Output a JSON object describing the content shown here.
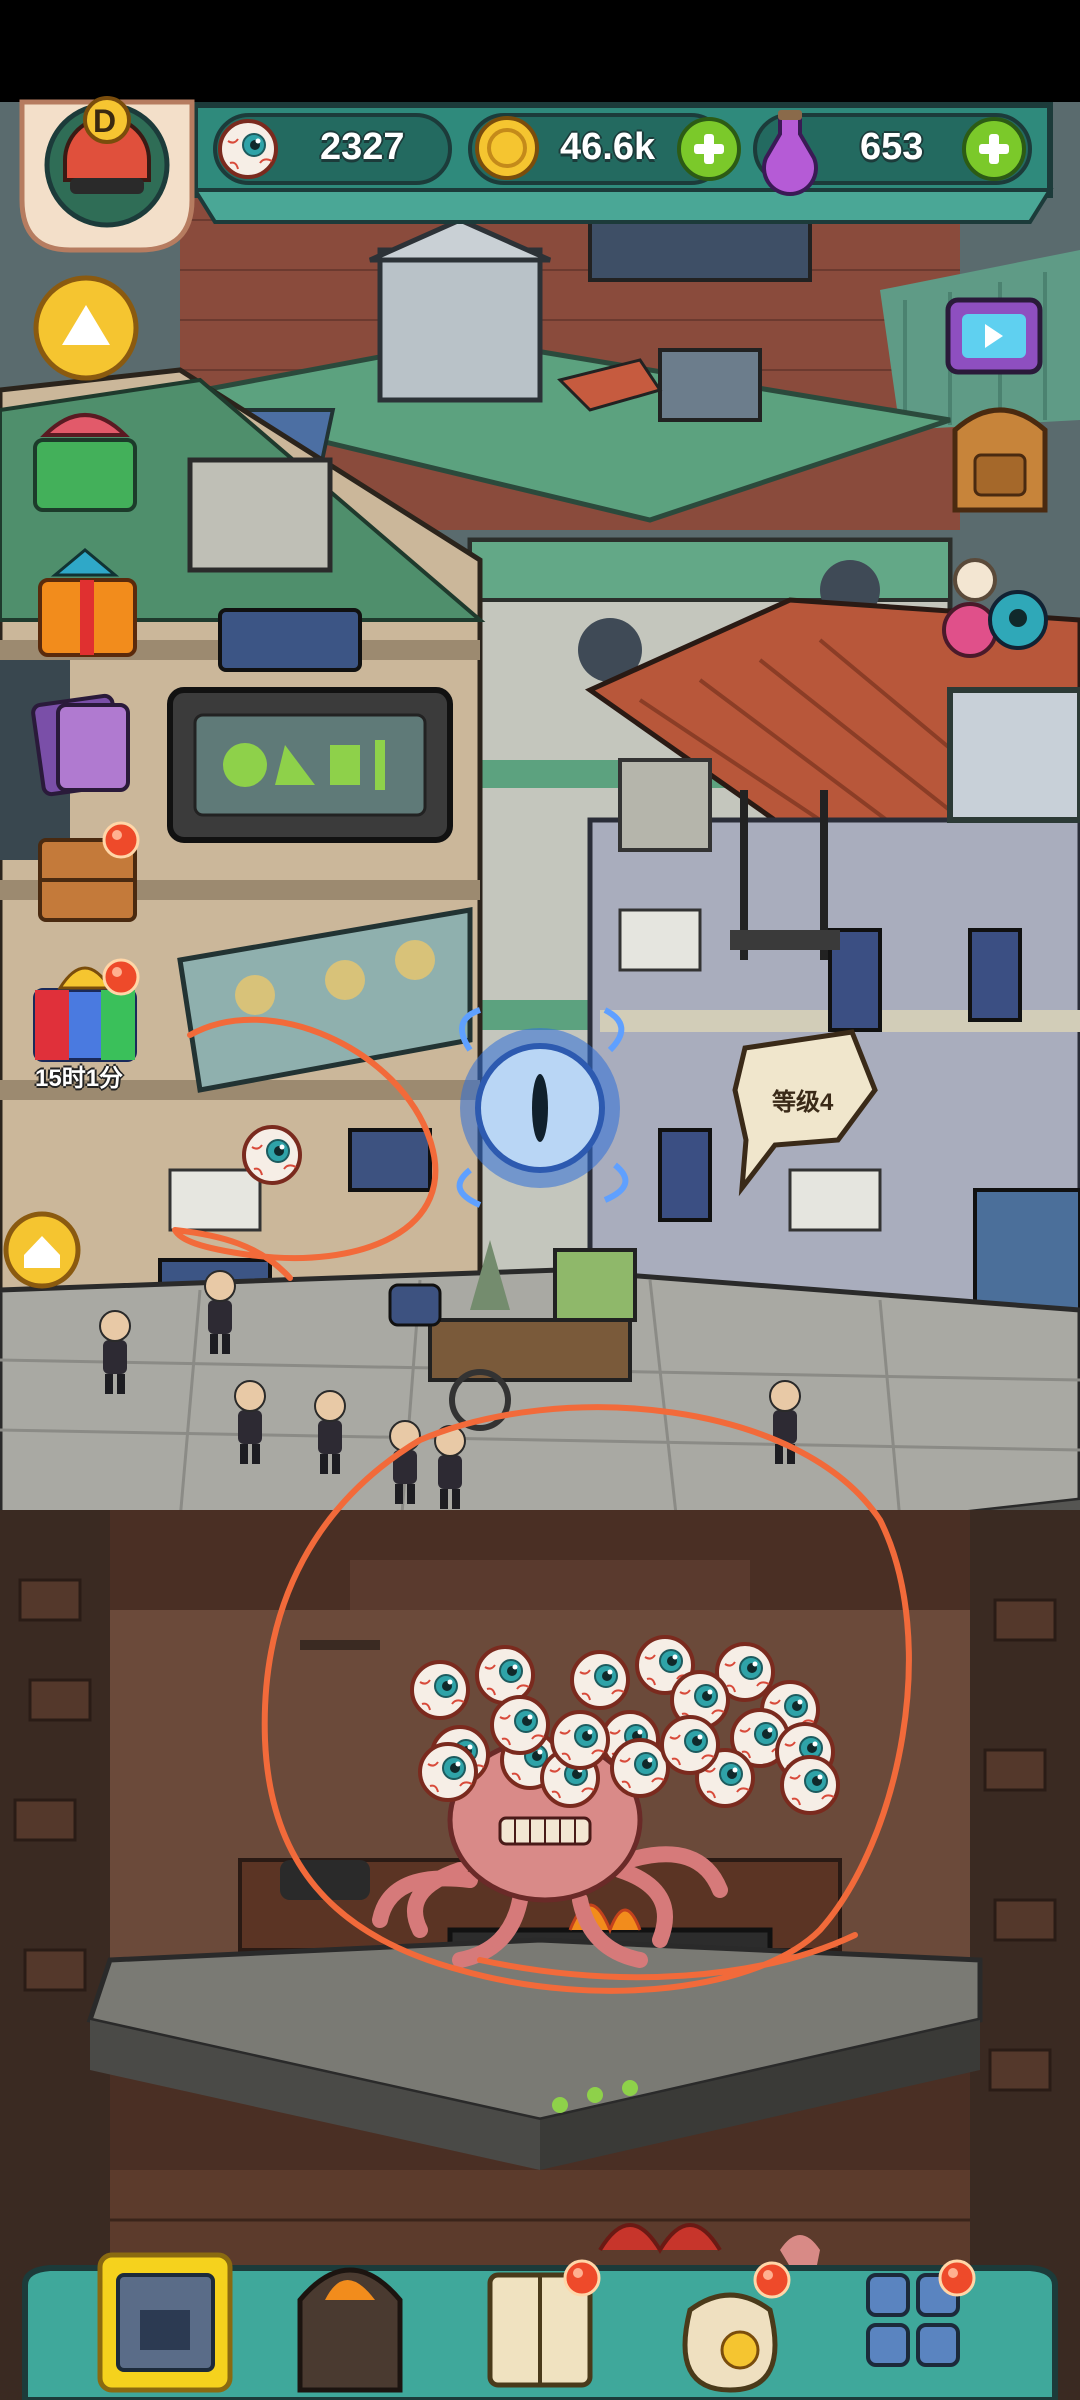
{
  "hud": {
    "eyeballs": "2327",
    "coins": "46.6k",
    "potions": "653",
    "player_badge": "D",
    "eyeball_icon": "eyeball-icon",
    "coin_icon": "coin-icon",
    "potion_icon": "potion-icon",
    "add_icon": "plus-icon"
  },
  "left_panel": {
    "gift_timer": "15时1分",
    "icons": [
      "arrow-up-icon",
      "gift-icon",
      "present-icon",
      "cards-icon",
      "crate-icon",
      "rainbow-gift-icon",
      "home-icon"
    ]
  },
  "right_panel": {
    "icons": [
      "tv-icon",
      "backpack-icon",
      "monster-eggs-icon"
    ]
  },
  "world": {
    "level_label": "等级4",
    "portal_icon": "eye-portal-icon"
  },
  "bottom_nav": {
    "items": [
      "shop-icon",
      "furnace-icon",
      "recipe-book-icon",
      "money-bag-icon",
      "grid-menu-icon"
    ]
  },
  "colors": {
    "hud_teal": "#2f8a7c",
    "hud_dark": "#1c3b3a",
    "plus_green": "#8ac926",
    "badge_red": "#ee4a2a",
    "annotation": "#f26a3a",
    "nav_teal": "#3fa89b",
    "nav_selected": "#f5d21d"
  }
}
